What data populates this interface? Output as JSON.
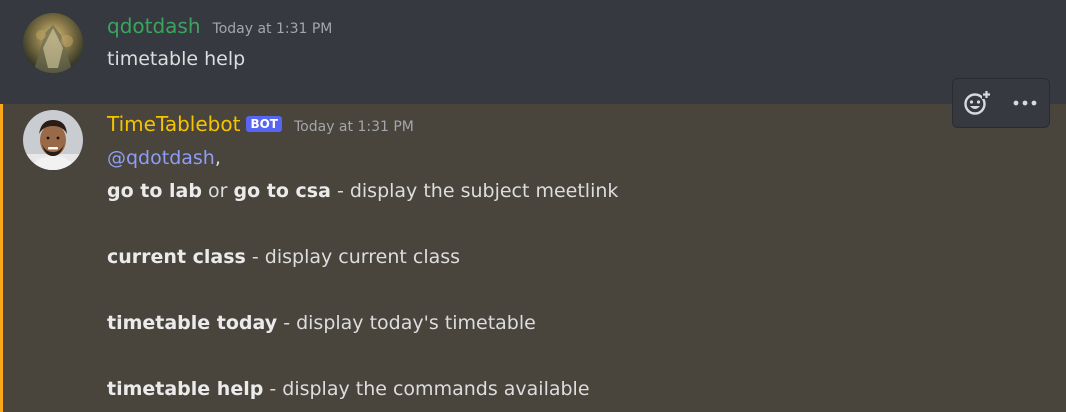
{
  "messages": {
    "first": {
      "username": "qdotdash",
      "timestamp": "Today at 1:31 PM",
      "text": "timetable help",
      "username_color": "#3ba55d"
    },
    "second": {
      "username": "TimeTablebot",
      "bot_tag": "BOT",
      "timestamp": "Today at 1:31 PM",
      "mention": "@qdotdash",
      "mention_suffix": ",",
      "username_color": "#f5c400",
      "lines": [
        {
          "cmd1": "go to lab",
          "or": " or ",
          "cmd2": "go to csa",
          "desc": " - display the subject meetlink"
        },
        {
          "cmd": "current class",
          "desc": " - display current class"
        },
        {
          "cmd": "timetable today",
          "desc": " - display today's timetable"
        },
        {
          "cmd": "timetable help",
          "desc": " - display the commands available"
        }
      ]
    }
  },
  "toolbar": {
    "add_reaction_icon": "add-reaction-icon",
    "more_icon": "more-options-icon"
  },
  "colors": {
    "background": "#36393f",
    "highlight_background": "#49443c",
    "highlight_border": "#faa81a",
    "mention": "#8e9ef6",
    "bot_tag": "#5865f2"
  }
}
